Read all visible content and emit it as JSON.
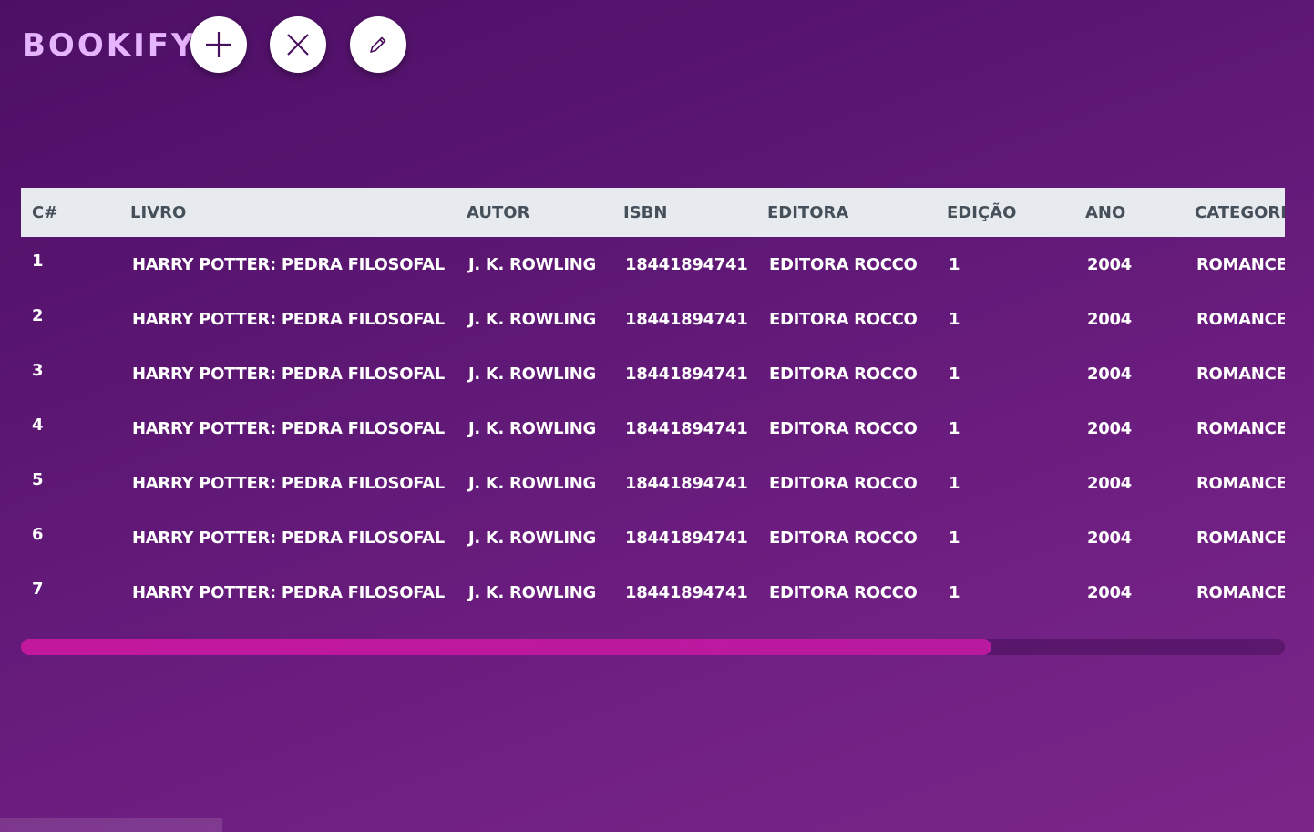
{
  "app": {
    "title": "BOOKIFY"
  },
  "toolbar": {
    "add_icon": "plus-icon",
    "remove_icon": "close-icon",
    "edit_icon": "pencil-icon"
  },
  "table": {
    "columns": [
      "C#",
      "LIVRO",
      "AUTOR",
      "ISBN",
      "EDITORA",
      "EDIÇÃO",
      "ANO",
      "CATEGORIA"
    ],
    "rows": [
      [
        "1",
        "HARRY POTTER: PEDRA FILOSOFAL",
        "J. K. ROWLING",
        "18441894741",
        "EDITORA ROCCO",
        "1",
        "2004",
        "ROMANCE"
      ],
      [
        "2",
        "HARRY POTTER: PEDRA FILOSOFAL",
        "J. K. ROWLING",
        "18441894741",
        "EDITORA ROCCO",
        "1",
        "2004",
        "ROMANCE"
      ],
      [
        "3",
        "HARRY POTTER: PEDRA FILOSOFAL",
        "J. K. ROWLING",
        "18441894741",
        "EDITORA ROCCO",
        "1",
        "2004",
        "ROMANCE"
      ],
      [
        "4",
        "HARRY POTTER: PEDRA FILOSOFAL",
        "J. K. ROWLING",
        "18441894741",
        "EDITORA ROCCO",
        "1",
        "2004",
        "ROMANCE"
      ],
      [
        "5",
        "HARRY POTTER: PEDRA FILOSOFAL",
        "J. K. ROWLING",
        "18441894741",
        "EDITORA ROCCO",
        "1",
        "2004",
        "ROMANCE"
      ],
      [
        "6",
        "HARRY POTTER: PEDRA FILOSOFAL",
        "J. K. ROWLING",
        "18441894741",
        "EDITORA ROCCO",
        "1",
        "2004",
        "ROMANCE"
      ],
      [
        "7",
        "HARRY POTTER: PEDRA FILOSOFAL",
        "J. K. ROWLING",
        "18441894741",
        "EDITORA ROCCO",
        "1",
        "2004",
        "ROMANCE"
      ]
    ]
  },
  "scrollbar": {
    "position_fraction": 0.77
  },
  "colors": {
    "brand": "#e6b3ff",
    "header_bg": "#e7eaee",
    "scroll_thumb": "#c2189e",
    "background": "#5c1773"
  }
}
